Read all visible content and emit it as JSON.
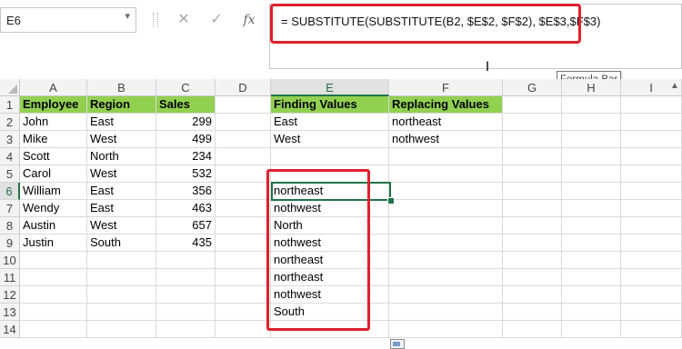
{
  "name_box": {
    "value": "E6",
    "dropdown_icon": "chevron-down-icon"
  },
  "formula_bar": {
    "formula": "= SUBSTITUTE(SUBSTITUTE(B2, $E$2, $F$2), $E$3,$F$3)",
    "cancel_glyph": "✕",
    "enter_glyph": "✓",
    "fx_label": "fx",
    "tooltip": "Formula Bar",
    "highlight_color": "#e0202c"
  },
  "columns": [
    "A",
    "B",
    "C",
    "D",
    "E",
    "F",
    "G",
    "H",
    "I"
  ],
  "selected_column": "E",
  "rows": [
    "1",
    "2",
    "3",
    "4",
    "5",
    "6",
    "7",
    "8",
    "9",
    "10",
    "11",
    "12",
    "13",
    "14"
  ],
  "selected_row": "6",
  "header_fill_color": "#92d050",
  "active_cell_color": "#217346",
  "table": {
    "headers": {
      "employee": "Employee",
      "region": "Region",
      "sales": "Sales"
    },
    "records": [
      {
        "employee": "John",
        "region": "East",
        "sales": "299"
      },
      {
        "employee": "Mike",
        "region": "West",
        "sales": "499"
      },
      {
        "employee": "Scott",
        "region": "North",
        "sales": "234"
      },
      {
        "employee": "Carol",
        "region": "West",
        "sales": "532"
      },
      {
        "employee": "William",
        "region": "East",
        "sales": "356"
      },
      {
        "employee": "Wendy",
        "region": "East",
        "sales": "463"
      },
      {
        "employee": "Austin",
        "region": "West",
        "sales": "657"
      },
      {
        "employee": "Justin",
        "region": "South",
        "sales": "435"
      }
    ]
  },
  "lookup": {
    "headers": {
      "find": "Finding Values",
      "replace": "Replacing Values"
    },
    "rows": [
      {
        "find": "East",
        "replace": "northeast"
      },
      {
        "find": "West",
        "replace": "nothwest"
      }
    ]
  },
  "results": [
    "northeast",
    "nothwest",
    "North",
    "nothwest",
    "northeast",
    "northeast",
    "nothwest",
    "South"
  ]
}
